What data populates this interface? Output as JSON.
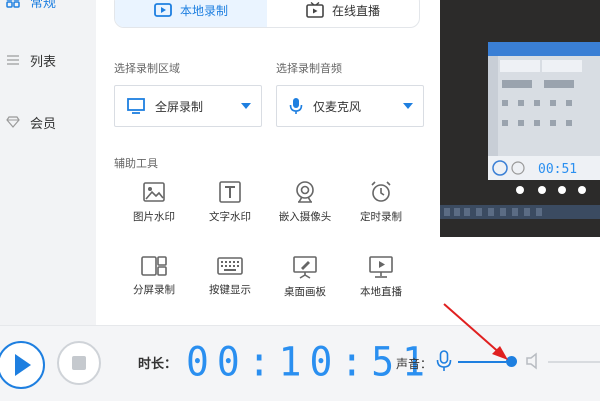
{
  "sidebar": {
    "items": [
      {
        "label": "常规",
        "icon": "grid-icon",
        "active": true
      },
      {
        "label": "列表",
        "icon": "list-icon",
        "active": false
      },
      {
        "label": "会员",
        "icon": "diamond-icon",
        "active": false
      }
    ]
  },
  "tabs": [
    {
      "label": "本地录制",
      "icon": "video-icon",
      "active": true
    },
    {
      "label": "在线直播",
      "icon": "tv-icon",
      "active": false
    }
  ],
  "capture": {
    "area_label": "选择录制区域",
    "area_value": "全屏录制",
    "audio_label": "选择录制音频",
    "audio_value": "仅麦克风"
  },
  "tools": {
    "section_label": "辅助工具",
    "items": [
      {
        "label": "图片水印",
        "icon": "image-watermark-icon"
      },
      {
        "label": "文字水印",
        "icon": "text-watermark-icon"
      },
      {
        "label": "嵌入摄像头",
        "icon": "webcam-icon"
      },
      {
        "label": "定时录制",
        "icon": "alarm-clock-icon"
      },
      {
        "label": "分屏录制",
        "icon": "split-screen-icon"
      },
      {
        "label": "按键显示",
        "icon": "keyboard-icon"
      },
      {
        "label": "桌面画板",
        "icon": "drawing-board-icon"
      },
      {
        "label": "本地直播",
        "icon": "monitor-play-icon"
      }
    ]
  },
  "bottom": {
    "duration_label": "时长：",
    "timer": "00:10:51",
    "sound_label": "声音：",
    "mic_level": 0.82
  },
  "colors": {
    "accent": "#1e7fe0",
    "timer": "#2a8ff0",
    "annotation": "#e02020"
  }
}
